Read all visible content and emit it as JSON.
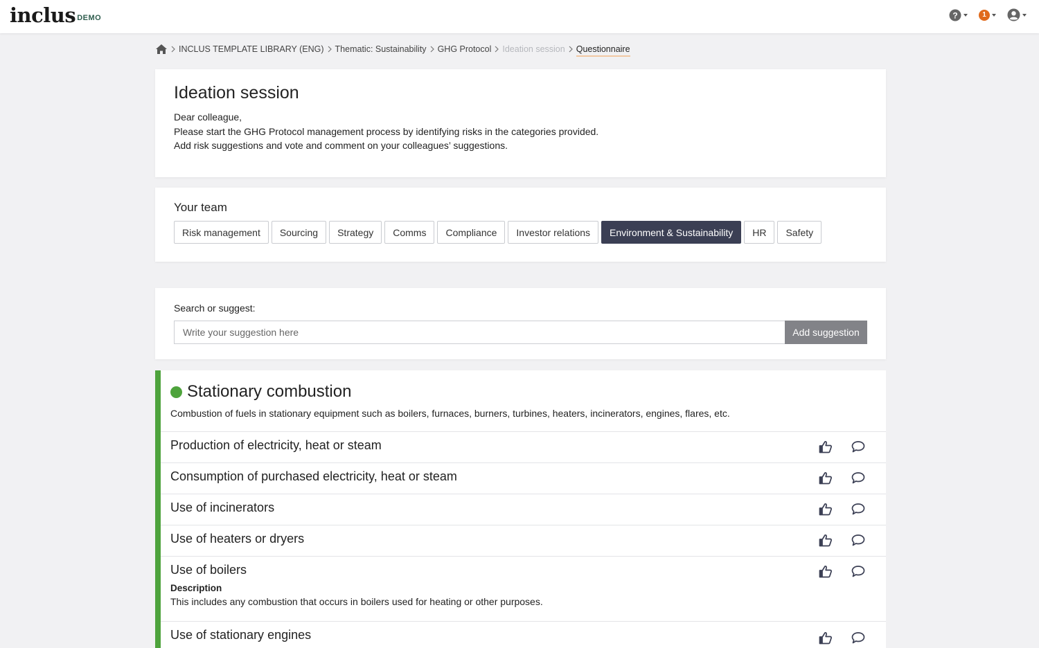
{
  "app": {
    "logo_main": "inclus",
    "logo_badge": "DEMO"
  },
  "topbar": {
    "help_icon": "help-circle-icon",
    "notifications_count": "1",
    "user_icon": "user-circle-icon"
  },
  "breadcrumb": {
    "home_icon": "home-icon",
    "items": [
      {
        "label": "INCLUS TEMPLATE LIBRARY (ENG)"
      },
      {
        "label": "Thematic: Sustainability"
      },
      {
        "label": "GHG Protocol"
      },
      {
        "label": "Ideation session"
      },
      {
        "label": "Questionnaire"
      }
    ]
  },
  "intro": {
    "title": "Ideation session",
    "lines": [
      "Dear colleague,",
      "Please start the GHG Protocol management process by identifying risks in the categories provided.",
      "Add risk suggestions and vote and comment on your colleagues’ suggestions."
    ]
  },
  "team": {
    "title": "Your team",
    "tabs": [
      {
        "label": "Risk management"
      },
      {
        "label": "Sourcing"
      },
      {
        "label": "Strategy"
      },
      {
        "label": "Comms"
      },
      {
        "label": "Compliance"
      },
      {
        "label": "Investor relations"
      },
      {
        "label": "Environment & Sustainability"
      },
      {
        "label": "HR"
      },
      {
        "label": "Safety"
      }
    ],
    "active_tab": "Environment & Sustainability"
  },
  "search": {
    "label": "Search or suggest:",
    "placeholder": "Write your suggestion here",
    "button": "Add suggestion"
  },
  "category": {
    "title": "Stationary combustion",
    "description": "Combustion of fuels in stationary equipment such as boilers, furnaces, burners, turbines, heaters, incinerators, engines, flares, etc.",
    "accent_color": "#4ea33c",
    "items": [
      {
        "title": "Production of electricity, heat or steam"
      },
      {
        "title": "Consumption of purchased electricity, heat or steam"
      },
      {
        "title": "Use of incinerators"
      },
      {
        "title": "Use of heaters or dryers"
      },
      {
        "title": "Use of boilers",
        "desc_label": "Description",
        "desc": "This includes any combustion that occurs in boilers used for heating or other purposes."
      },
      {
        "title": "Use of stationary engines"
      }
    ]
  },
  "colors": {
    "active_tab": "#3b3f54",
    "add_button": "#828388",
    "notification": "#e06a1c"
  }
}
